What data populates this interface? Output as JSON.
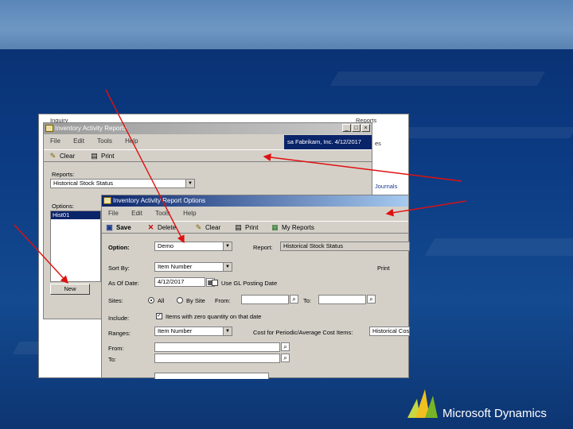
{
  "back_window": {
    "title": "Inquiry",
    "side_title": "Reports",
    "side_items": [
      "es",
      "Journals"
    ]
  },
  "reports_window": {
    "title": "Inventory Activity Reports",
    "menu": [
      "File",
      "Edit",
      "Tools",
      "Help"
    ],
    "toolbar": {
      "clear": "Clear",
      "print": "Print"
    },
    "company_date": "sa Fabrikam, Inc. 4/12/2017",
    "reports_label": "Reports:",
    "reports_value": "Historical Stock Status",
    "options_label": "Options:",
    "options_list": [
      "Hist01"
    ],
    "new_button": "New"
  },
  "options_window": {
    "title": "Inventory Activity Report Options",
    "menu": [
      "File",
      "Edit",
      "Tools",
      "Help"
    ],
    "toolbar": {
      "save": "Save",
      "delete": "Delete",
      "clear": "Clear",
      "print": "Print",
      "my_reports": "My Reports"
    },
    "option_label": "Option:",
    "option_value": "Demo",
    "report_label": "Report:",
    "report_value": "Historical Stock Status",
    "sort_by_label": "Sort By:",
    "sort_by_value": "Item Number",
    "print_label": "Print",
    "as_of_label": "As Of Date:",
    "as_of_value": "4/12/2017",
    "use_gl_label": "Use GL Posting Date",
    "sites_label": "Sites:",
    "all_label": "All",
    "by_site_label": "By Site",
    "from_label": "From:",
    "to_label": "To:",
    "include_label": "Include:",
    "include_value": "Items with zero quantity on that date",
    "ranges_label": "Ranges:",
    "ranges_value": "Item Number",
    "cost_label": "Cost for Periodic/Average Cost Items:",
    "cost_value": "Historical Cost",
    "range_from_label": "From:",
    "range_to_label": "To:"
  },
  "logo": {
    "text": "Microsoft Dynamics"
  },
  "colors": {
    "arrow": "#e01010",
    "title_active": "#0a246a",
    "window_face": "#d4d0c8"
  }
}
